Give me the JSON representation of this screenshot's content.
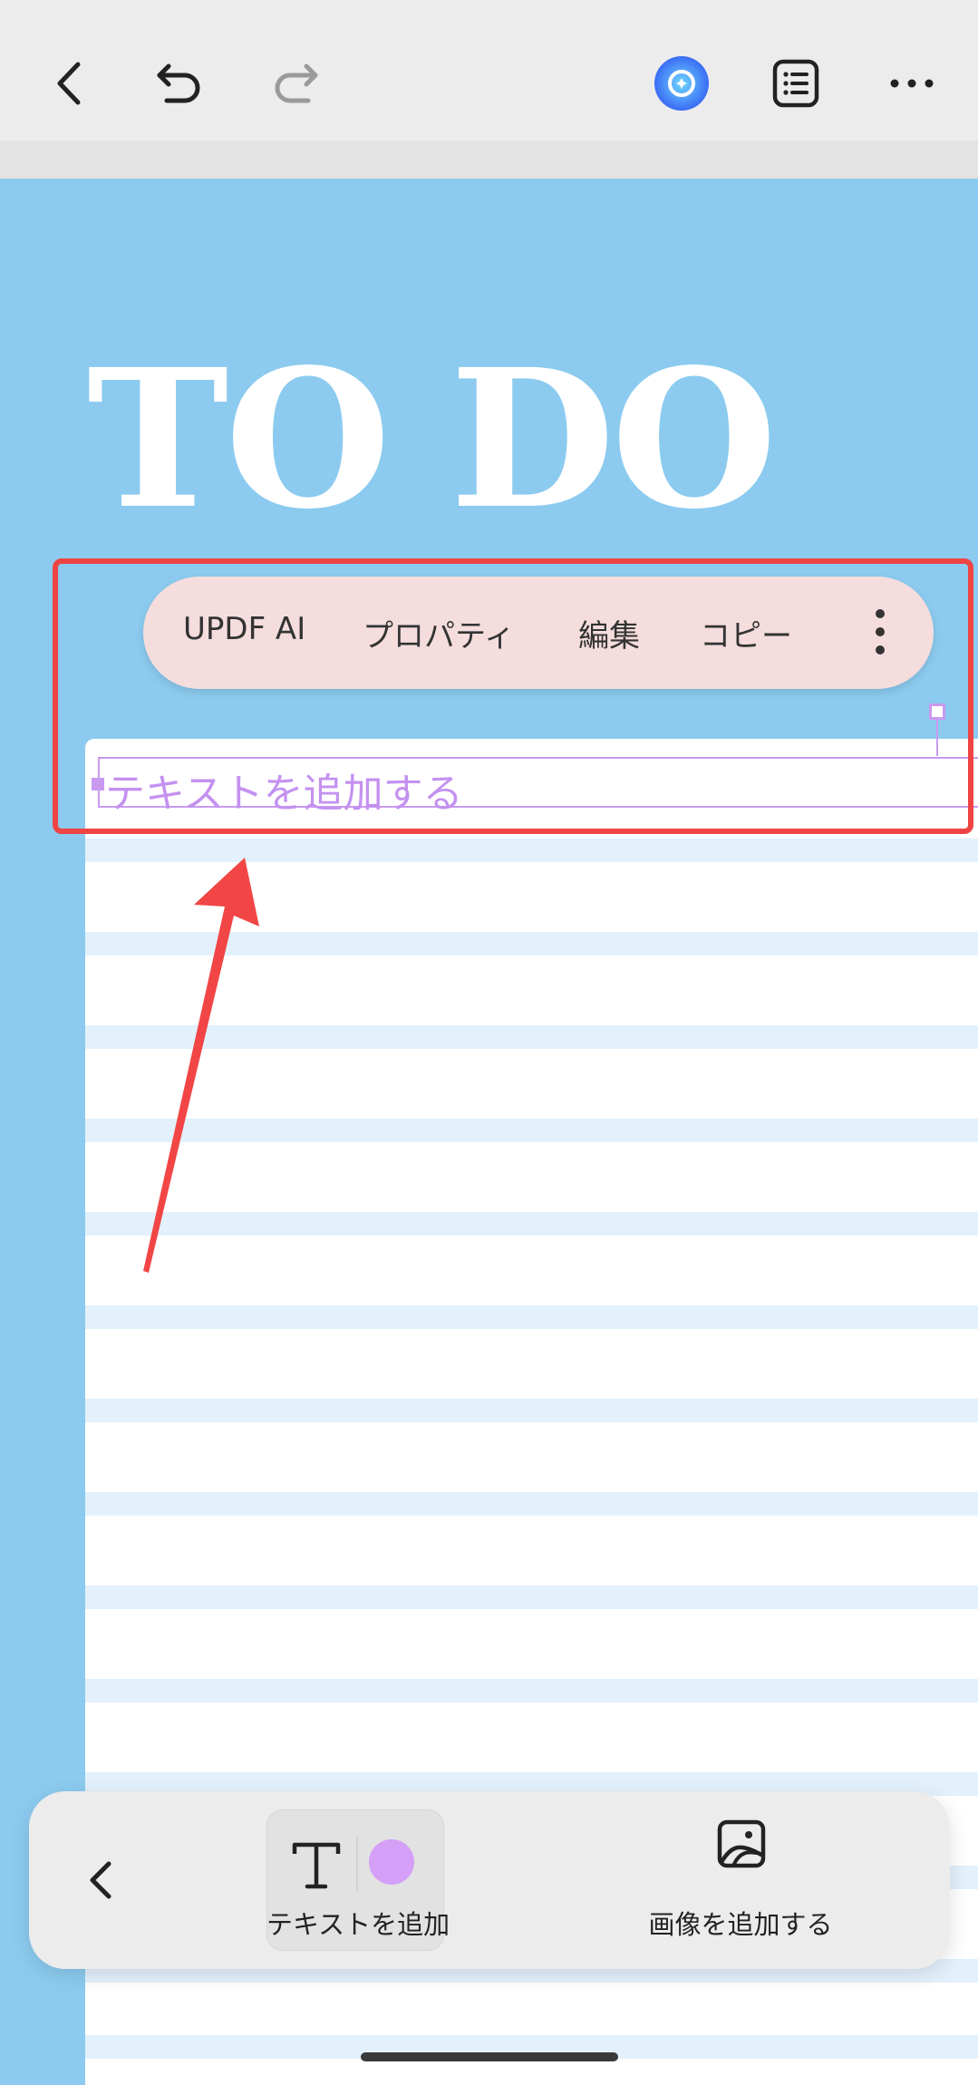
{
  "page": {
    "title": "TO DO"
  },
  "context_menu": {
    "items": [
      "UPDF AI",
      "プロパティ",
      "編集",
      "コピー"
    ]
  },
  "text_box": {
    "placeholder": "テキストを追加する"
  },
  "bottom_toolbar": {
    "add_text_label": "テキストを追加",
    "add_image_label": "画像を追加する",
    "text_color": "#d49ff7"
  },
  "colors": {
    "background": "#8ccbef",
    "highlight": "#ee4444",
    "selection": "#c99af0"
  }
}
